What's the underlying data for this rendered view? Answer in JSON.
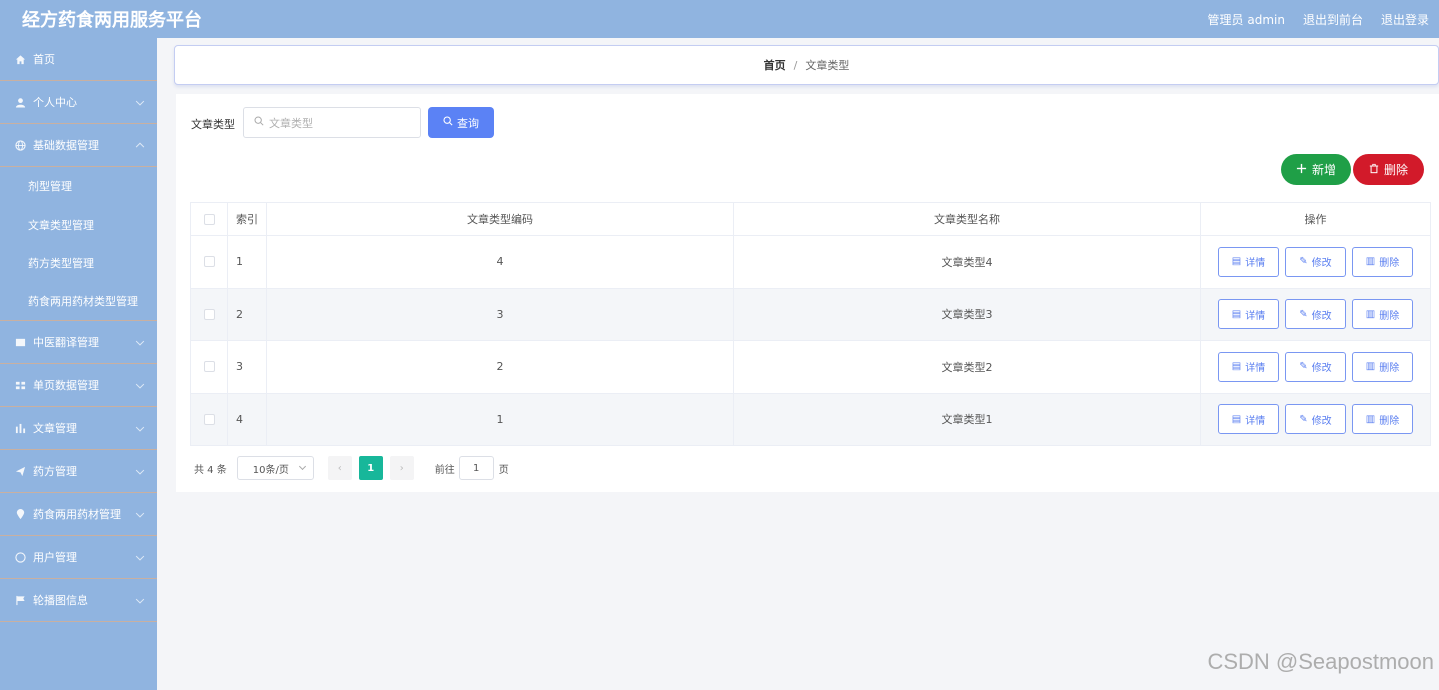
{
  "header": {
    "title": "经方药食两用服务平台",
    "admin": "管理员 admin",
    "back_front": "退出到前台",
    "logout": "退出登录"
  },
  "sidebar": {
    "items": [
      {
        "label": "首页",
        "icon": "home-icon"
      },
      {
        "label": "个人中心",
        "icon": "user-icon"
      },
      {
        "label": "基础数据管理",
        "icon": "globe-icon"
      },
      {
        "label": "中医翻译管理",
        "icon": "book-icon"
      },
      {
        "label": "单页数据管理",
        "icon": "grid-icon"
      },
      {
        "label": "文章管理",
        "icon": "chart-icon"
      },
      {
        "label": "药方管理",
        "icon": "send-icon"
      },
      {
        "label": "药食两用药材管理",
        "icon": "pin-icon"
      },
      {
        "label": "用户管理",
        "icon": "clock-icon"
      },
      {
        "label": "轮播图信息",
        "icon": "flag-icon"
      }
    ],
    "subitems": [
      "剂型管理",
      "文章类型管理",
      "药方类型管理",
      "药食两用药材类型管理"
    ]
  },
  "breadcrumb": {
    "home": "首页",
    "sep": "/",
    "current": "文章类型"
  },
  "search": {
    "label": "文章类型",
    "placeholder": "文章类型",
    "button": "查询"
  },
  "actions": {
    "add": "新增",
    "delete": "删除"
  },
  "table": {
    "columns": [
      "索引",
      "文章类型编码",
      "文章类型名称",
      "操作"
    ],
    "rows": [
      {
        "index": "1",
        "code": "4",
        "name": "文章类型4"
      },
      {
        "index": "2",
        "code": "3",
        "name": "文章类型3"
      },
      {
        "index": "3",
        "code": "2",
        "name": "文章类型2"
      },
      {
        "index": "4",
        "code": "1",
        "name": "文章类型1"
      }
    ],
    "op_detail": "详情",
    "op_edit": "修改",
    "op_delete": "删除"
  },
  "pager": {
    "total": "共 4 条",
    "size": "10条/页",
    "current_page": "1",
    "goto_label": "前往",
    "goto_value": "1",
    "page_unit": "页"
  },
  "watermark": "CSDN @Seapostmoon",
  "colors": {
    "primary": "#5b82f5",
    "success": "#1f9f47",
    "danger": "#d21a2a",
    "sidebar": "#90b4e0"
  }
}
